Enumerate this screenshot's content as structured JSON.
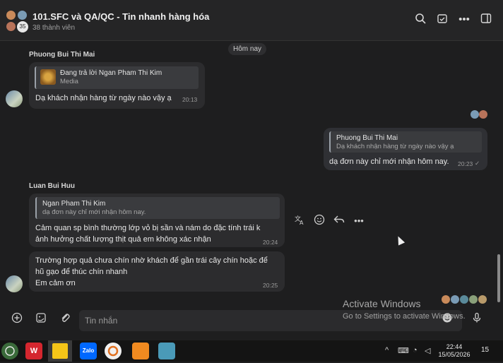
{
  "header": {
    "title": "101.SFC và QA/QC - Tin nhanh hàng hóa",
    "member_count_badge": "35",
    "subtitle": "38 thành viên",
    "icons": [
      "search-icon",
      "calendar-check-icon",
      "more-icon",
      "sidebar-toggle-icon"
    ]
  },
  "chat": {
    "date_divider": "Hôm nay",
    "messages": [
      {
        "sender": "Phuong Bui Thi Mai",
        "quote_name": "Đang trả lời Ngan Pham Thi Kim",
        "quote_text": "Media",
        "text": "Dạ khách nhận hàng từ ngày nào vậy ạ",
        "time": "20:13"
      },
      {
        "sender": "",
        "quote_name": "Phuong Bui Thi Mai",
        "quote_text": "Dạ khách nhận hàng từ ngày nào vậy ạ",
        "text": "dạ đơn này chỉ mới nhận hôm nay.",
        "time": "20:23"
      },
      {
        "sender": "Luan Bui Huu",
        "quote_name": "Ngan Pham Thi Kim",
        "quote_text": "dạ đơn này chỉ mới nhận hôm nay.",
        "text_lines": [
          "Cảm quan sp bình thường lớp vỏ bị sần và nám do đặc tính trái k",
          "ảnh hưởng chất lượng thịt quả em không xác nhận"
        ],
        "time": "20:24"
      },
      {
        "sender": "",
        "text_lines": [
          "Trường hợp quả chưa chín nhờ khách để gần trái cây chín hoặc để",
          "hũ gạo để thúc chín nhanh",
          "Em cảm ơn"
        ],
        "time": "20:25"
      }
    ],
    "hover_actions": [
      "translate-icon",
      "emoji-icon",
      "reply-icon",
      "more-icon"
    ]
  },
  "input": {
    "placeholder": "Tin nhắn"
  },
  "watermark": {
    "line1": "Activate Windows",
    "line2": "Go to Settings to activate Windows."
  },
  "taskbar": {
    "apps": [
      "start",
      "wps",
      "sticky-notes",
      "zalo",
      "browser",
      "app-orange",
      "app-blue"
    ],
    "zalo_label": "Zalo",
    "time": "22:44",
    "date": "15/05/2026",
    "notification_count": "15"
  },
  "colors": {
    "background": "#1e1e1f",
    "bubble": "#2c2c2e",
    "wps_red": "#d4262e",
    "sticky_yellow": "#f5c518",
    "zalo_blue": "#0068ff"
  }
}
